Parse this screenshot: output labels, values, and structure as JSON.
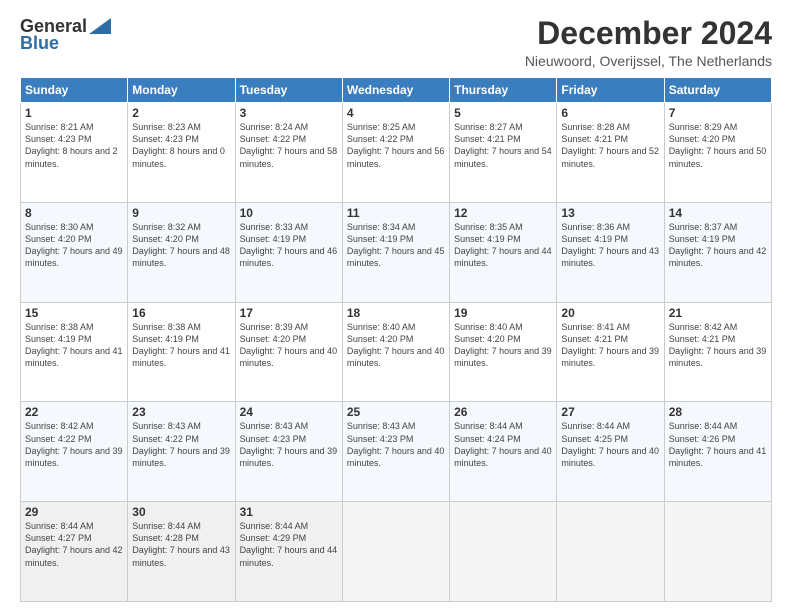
{
  "header": {
    "logo_general": "General",
    "logo_blue": "Blue",
    "month_title": "December 2024",
    "location": "Nieuwoord, Overijssel, The Netherlands"
  },
  "days_of_week": [
    "Sunday",
    "Monday",
    "Tuesday",
    "Wednesday",
    "Thursday",
    "Friday",
    "Saturday"
  ],
  "weeks": [
    [
      {
        "day": "1",
        "sunrise": "8:21 AM",
        "sunset": "4:23 PM",
        "daylight": "8 hours and 2 minutes"
      },
      {
        "day": "2",
        "sunrise": "8:23 AM",
        "sunset": "4:23 PM",
        "daylight": "8 hours and 0 minutes"
      },
      {
        "day": "3",
        "sunrise": "8:24 AM",
        "sunset": "4:22 PM",
        "daylight": "7 hours and 58 minutes"
      },
      {
        "day": "4",
        "sunrise": "8:25 AM",
        "sunset": "4:22 PM",
        "daylight": "7 hours and 56 minutes"
      },
      {
        "day": "5",
        "sunrise": "8:27 AM",
        "sunset": "4:21 PM",
        "daylight": "7 hours and 54 minutes"
      },
      {
        "day": "6",
        "sunrise": "8:28 AM",
        "sunset": "4:21 PM",
        "daylight": "7 hours and 52 minutes"
      },
      {
        "day": "7",
        "sunrise": "8:29 AM",
        "sunset": "4:20 PM",
        "daylight": "7 hours and 50 minutes"
      }
    ],
    [
      {
        "day": "8",
        "sunrise": "8:30 AM",
        "sunset": "4:20 PM",
        "daylight": "7 hours and 49 minutes"
      },
      {
        "day": "9",
        "sunrise": "8:32 AM",
        "sunset": "4:20 PM",
        "daylight": "7 hours and 48 minutes"
      },
      {
        "day": "10",
        "sunrise": "8:33 AM",
        "sunset": "4:19 PM",
        "daylight": "7 hours and 46 minutes"
      },
      {
        "day": "11",
        "sunrise": "8:34 AM",
        "sunset": "4:19 PM",
        "daylight": "7 hours and 45 minutes"
      },
      {
        "day": "12",
        "sunrise": "8:35 AM",
        "sunset": "4:19 PM",
        "daylight": "7 hours and 44 minutes"
      },
      {
        "day": "13",
        "sunrise": "8:36 AM",
        "sunset": "4:19 PM",
        "daylight": "7 hours and 43 minutes"
      },
      {
        "day": "14",
        "sunrise": "8:37 AM",
        "sunset": "4:19 PM",
        "daylight": "7 hours and 42 minutes"
      }
    ],
    [
      {
        "day": "15",
        "sunrise": "8:38 AM",
        "sunset": "4:19 PM",
        "daylight": "7 hours and 41 minutes"
      },
      {
        "day": "16",
        "sunrise": "8:38 AM",
        "sunset": "4:19 PM",
        "daylight": "7 hours and 41 minutes"
      },
      {
        "day": "17",
        "sunrise": "8:39 AM",
        "sunset": "4:20 PM",
        "daylight": "7 hours and 40 minutes"
      },
      {
        "day": "18",
        "sunrise": "8:40 AM",
        "sunset": "4:20 PM",
        "daylight": "7 hours and 40 minutes"
      },
      {
        "day": "19",
        "sunrise": "8:40 AM",
        "sunset": "4:20 PM",
        "daylight": "7 hours and 39 minutes"
      },
      {
        "day": "20",
        "sunrise": "8:41 AM",
        "sunset": "4:21 PM",
        "daylight": "7 hours and 39 minutes"
      },
      {
        "day": "21",
        "sunrise": "8:42 AM",
        "sunset": "4:21 PM",
        "daylight": "7 hours and 39 minutes"
      }
    ],
    [
      {
        "day": "22",
        "sunrise": "8:42 AM",
        "sunset": "4:22 PM",
        "daylight": "7 hours and 39 minutes"
      },
      {
        "day": "23",
        "sunrise": "8:43 AM",
        "sunset": "4:22 PM",
        "daylight": "7 hours and 39 minutes"
      },
      {
        "day": "24",
        "sunrise": "8:43 AM",
        "sunset": "4:23 PM",
        "daylight": "7 hours and 39 minutes"
      },
      {
        "day": "25",
        "sunrise": "8:43 AM",
        "sunset": "4:23 PM",
        "daylight": "7 hours and 40 minutes"
      },
      {
        "day": "26",
        "sunrise": "8:44 AM",
        "sunset": "4:24 PM",
        "daylight": "7 hours and 40 minutes"
      },
      {
        "day": "27",
        "sunrise": "8:44 AM",
        "sunset": "4:25 PM",
        "daylight": "7 hours and 40 minutes"
      },
      {
        "day": "28",
        "sunrise": "8:44 AM",
        "sunset": "4:26 PM",
        "daylight": "7 hours and 41 minutes"
      }
    ],
    [
      {
        "day": "29",
        "sunrise": "8:44 AM",
        "sunset": "4:27 PM",
        "daylight": "7 hours and 42 minutes"
      },
      {
        "day": "30",
        "sunrise": "8:44 AM",
        "sunset": "4:28 PM",
        "daylight": "7 hours and 43 minutes"
      },
      {
        "day": "31",
        "sunrise": "8:44 AM",
        "sunset": "4:29 PM",
        "daylight": "7 hours and 44 minutes"
      },
      null,
      null,
      null,
      null
    ]
  ]
}
